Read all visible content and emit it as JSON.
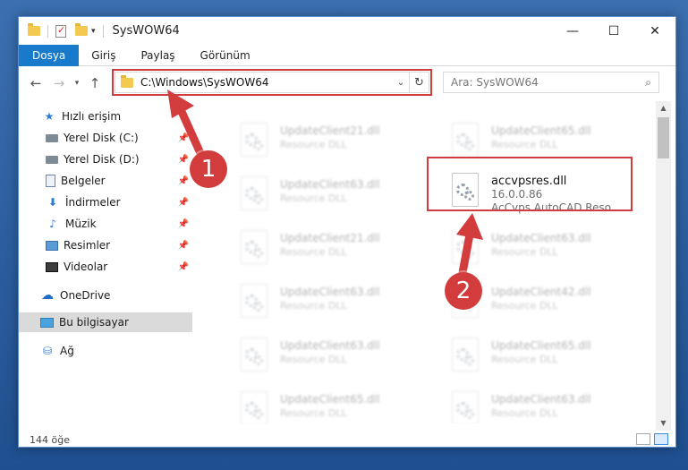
{
  "window": {
    "title": "SysWOW64",
    "controls": {
      "minimize": "—",
      "maximize": "☐",
      "close": "✕"
    }
  },
  "ribbon": {
    "tabs": [
      "Dosya",
      "Giriş",
      "Paylaş",
      "Görünüm"
    ]
  },
  "address": {
    "path": "C:\\Windows\\SysWOW64"
  },
  "search": {
    "placeholder": "Ara: SysWOW64"
  },
  "sidebar": {
    "items": [
      {
        "label": "Hızlı erişim",
        "icon": "quick-access-star-icon"
      },
      {
        "label": "Yerel Disk (C:)",
        "icon": "drive-icon",
        "pinned": true
      },
      {
        "label": "Yerel Disk (D:)",
        "icon": "drive-icon",
        "pinned": true
      },
      {
        "label": "Belgeler",
        "icon": "documents-icon",
        "pinned": true
      },
      {
        "label": "İndirmeler",
        "icon": "downloads-icon",
        "pinned": true
      },
      {
        "label": "Müzik",
        "icon": "music-icon",
        "pinned": true
      },
      {
        "label": "Resimler",
        "icon": "pictures-icon",
        "pinned": true
      },
      {
        "label": "Videolar",
        "icon": "videos-icon",
        "pinned": true
      },
      {
        "label": "OneDrive",
        "icon": "onedrive-cloud-icon"
      },
      {
        "label": "Bu bilgisayar",
        "icon": "this-pc-icon",
        "selected": true
      },
      {
        "label": "Ağ",
        "icon": "network-icon"
      }
    ]
  },
  "files": {
    "left": [
      {
        "name": "UpdateClient21.dll",
        "type": "Resource DLL"
      },
      {
        "name": "UpdateClient63.dll",
        "type": "Resource DLL"
      },
      {
        "name": "UpdateClient21.dll",
        "type": "Resource DLL"
      },
      {
        "name": "UpdateClient63.dll",
        "type": "Resource DLL"
      },
      {
        "name": "UpdateClient63.dll",
        "type": "Resource DLL"
      },
      {
        "name": "UpdateClient65.dll",
        "type": "Resource DLL"
      },
      {
        "name": "UpdateClient63.dll",
        "type": "Resource DLL"
      }
    ],
    "right": [
      {
        "name": "UpdateClient65.dll",
        "type": "Resource DLL"
      },
      {
        "name": "accvpsres.dll",
        "version": "16.0.0.86",
        "description": "AcCvps AutoCAD Reso...",
        "highlighted": true
      },
      {
        "name": "UpdateClient63.dll",
        "type": "Resource DLL"
      },
      {
        "name": "UpdateClient42.dll",
        "type": "Resource DLL"
      },
      {
        "name": "UpdateClient65.dll",
        "type": "Resource DLL"
      },
      {
        "name": "UpdateClient63.dll",
        "type": "Resource DLL"
      },
      {
        "name": "UpdateClient65.dll",
        "type": "Resource DLL"
      }
    ]
  },
  "status": {
    "count": "144 öğe"
  },
  "annotations": {
    "step1": "1",
    "step2": "2",
    "color": "#d33c3c"
  }
}
